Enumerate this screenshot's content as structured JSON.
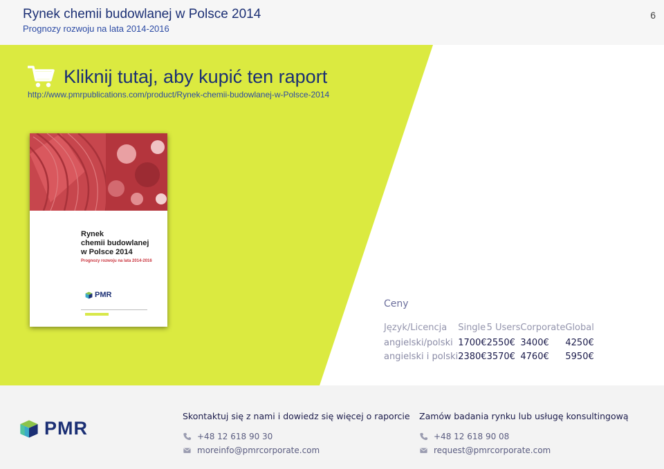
{
  "header": {
    "title": "Rynek chemii budowlanej w Polsce 2014",
    "subtitle": "Prognozy rozwoju na lata 2014-2016",
    "page_number": "6"
  },
  "buy": {
    "label": "Kliknij tutaj, aby kupić ten raport",
    "url": "http://www.pmrpublications.com/product/Rynek-chemii-budowlanej-w-Polsce-2014"
  },
  "cover": {
    "title": "Rynek\nchemii budowlanej\nw Polsce 2014",
    "subtitle": "Prognozy rozwoju na lata 2014-2016",
    "logo_text": "PMR"
  },
  "prices": {
    "title": "Ceny",
    "columns": [
      "Język/Licencja",
      "Single",
      "5 Users",
      "Corporate",
      "Global"
    ],
    "rows": [
      [
        "angielski/polski",
        "1700€",
        "2550€",
        "3400€",
        "4250€"
      ],
      [
        "angielski i polski",
        "2380€",
        "3570€",
        "4760€",
        "5950€"
      ]
    ]
  },
  "footer": {
    "logo_text": "PMR",
    "contact1": {
      "heading": "Skontaktuj się z nami i dowiedz się więcej o raporcie",
      "phone": "+48 12 618 90 30",
      "email": "moreinfo@pmrcorporate.com"
    },
    "contact2": {
      "heading": "Zamów badania rynku lub usługę konsultingową",
      "phone": "+48 12 618 90 08",
      "email": "request@pmrcorporate.com"
    }
  },
  "colors": {
    "accent_green": "#dbea40",
    "brand_navy": "#1b2f74",
    "cover_red": "#c23f47"
  }
}
